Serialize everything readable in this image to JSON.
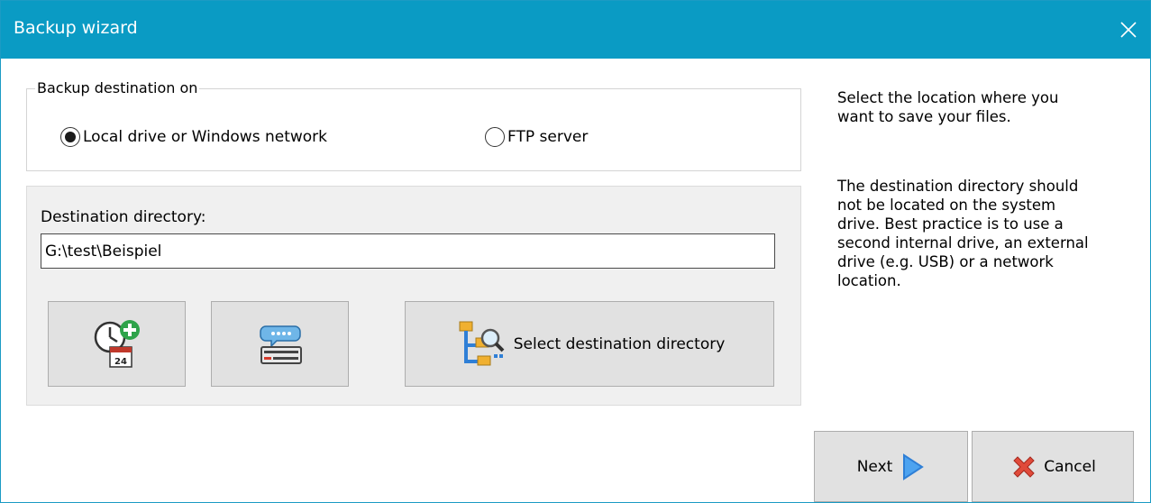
{
  "window": {
    "title": "Backup wizard"
  },
  "destination_group": {
    "legend": "Backup destination on",
    "options": [
      {
        "label": "Local drive or Windows network",
        "selected": true
      },
      {
        "label": "FTP server",
        "selected": false
      }
    ]
  },
  "destination": {
    "label": "Destination directory:",
    "value": "G:\\test\\Beispiel"
  },
  "buttons": {
    "select_dir_label": "Select destination directory",
    "next_label": "Next",
    "cancel_label": "Cancel"
  },
  "help": {
    "line1": [
      "Select the location where you",
      "want to save your files."
    ],
    "line2": [
      "The destination directory should",
      "not be located on the system",
      "drive. Best practice is to use a",
      "second internal drive, an external",
      "drive (e.g. USB) or a network",
      "location."
    ]
  },
  "icons": {
    "close": "close-icon",
    "schedule": "clock-calendar-add-icon",
    "message": "speech-bubble-form-icon",
    "folder_search": "folder-tree-search-icon",
    "next": "play-triangle-icon",
    "cancel": "red-x-icon"
  },
  "colors": {
    "titlebar": "#0a9bc4",
    "accent_blue": "#2f7fd6",
    "cancel_red": "#d63a2b",
    "panel": "#f0f0f0"
  }
}
